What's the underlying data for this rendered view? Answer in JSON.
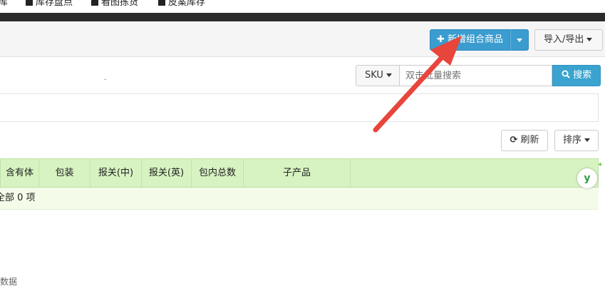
{
  "top_nav": {
    "items": [
      {
        "label": "库存盘点"
      },
      {
        "label": "看图拣货"
      },
      {
        "label": "皮案库存"
      }
    ],
    "partial_left": "库"
  },
  "toolbar": {
    "new_combo_label": "新增组合商品",
    "import_export_label": "导入/导出"
  },
  "search": {
    "field_label": "SKU",
    "placeholder": "双击批量搜索",
    "button_label": "搜索"
  },
  "list_actions": {
    "refresh_label": "刷新",
    "sort_label": "排序"
  },
  "table": {
    "columns": [
      "含有体",
      "包装",
      "报关(中)",
      "报关(英)",
      "包内总数",
      "子产品"
    ],
    "summary": "全部 0 项",
    "empty_text": "数据"
  },
  "colors": {
    "primary": "#3a9ccf",
    "header_green": "#d7f3c1",
    "arrow_red": "#e8453c"
  }
}
